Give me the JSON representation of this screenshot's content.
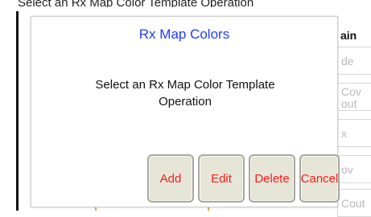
{
  "background": {
    "caption_fragment": "Select an Rx Map Color Template Operation",
    "right_panel": {
      "header": "ain",
      "cells": [
        "de",
        "Cov\nout",
        "x",
        "ov",
        "Cout"
      ]
    }
  },
  "dialog": {
    "title": "Rx Map Colors",
    "message": "Select an Rx Map Color Template Operation",
    "buttons": {
      "add": "Add",
      "edit": "Edit",
      "delete": "Delete",
      "cancel": "Cancel"
    }
  },
  "colors": {
    "title": "#1f3bff",
    "button_text": "#ff1a1a",
    "button_bg": "#e6e6d8"
  }
}
